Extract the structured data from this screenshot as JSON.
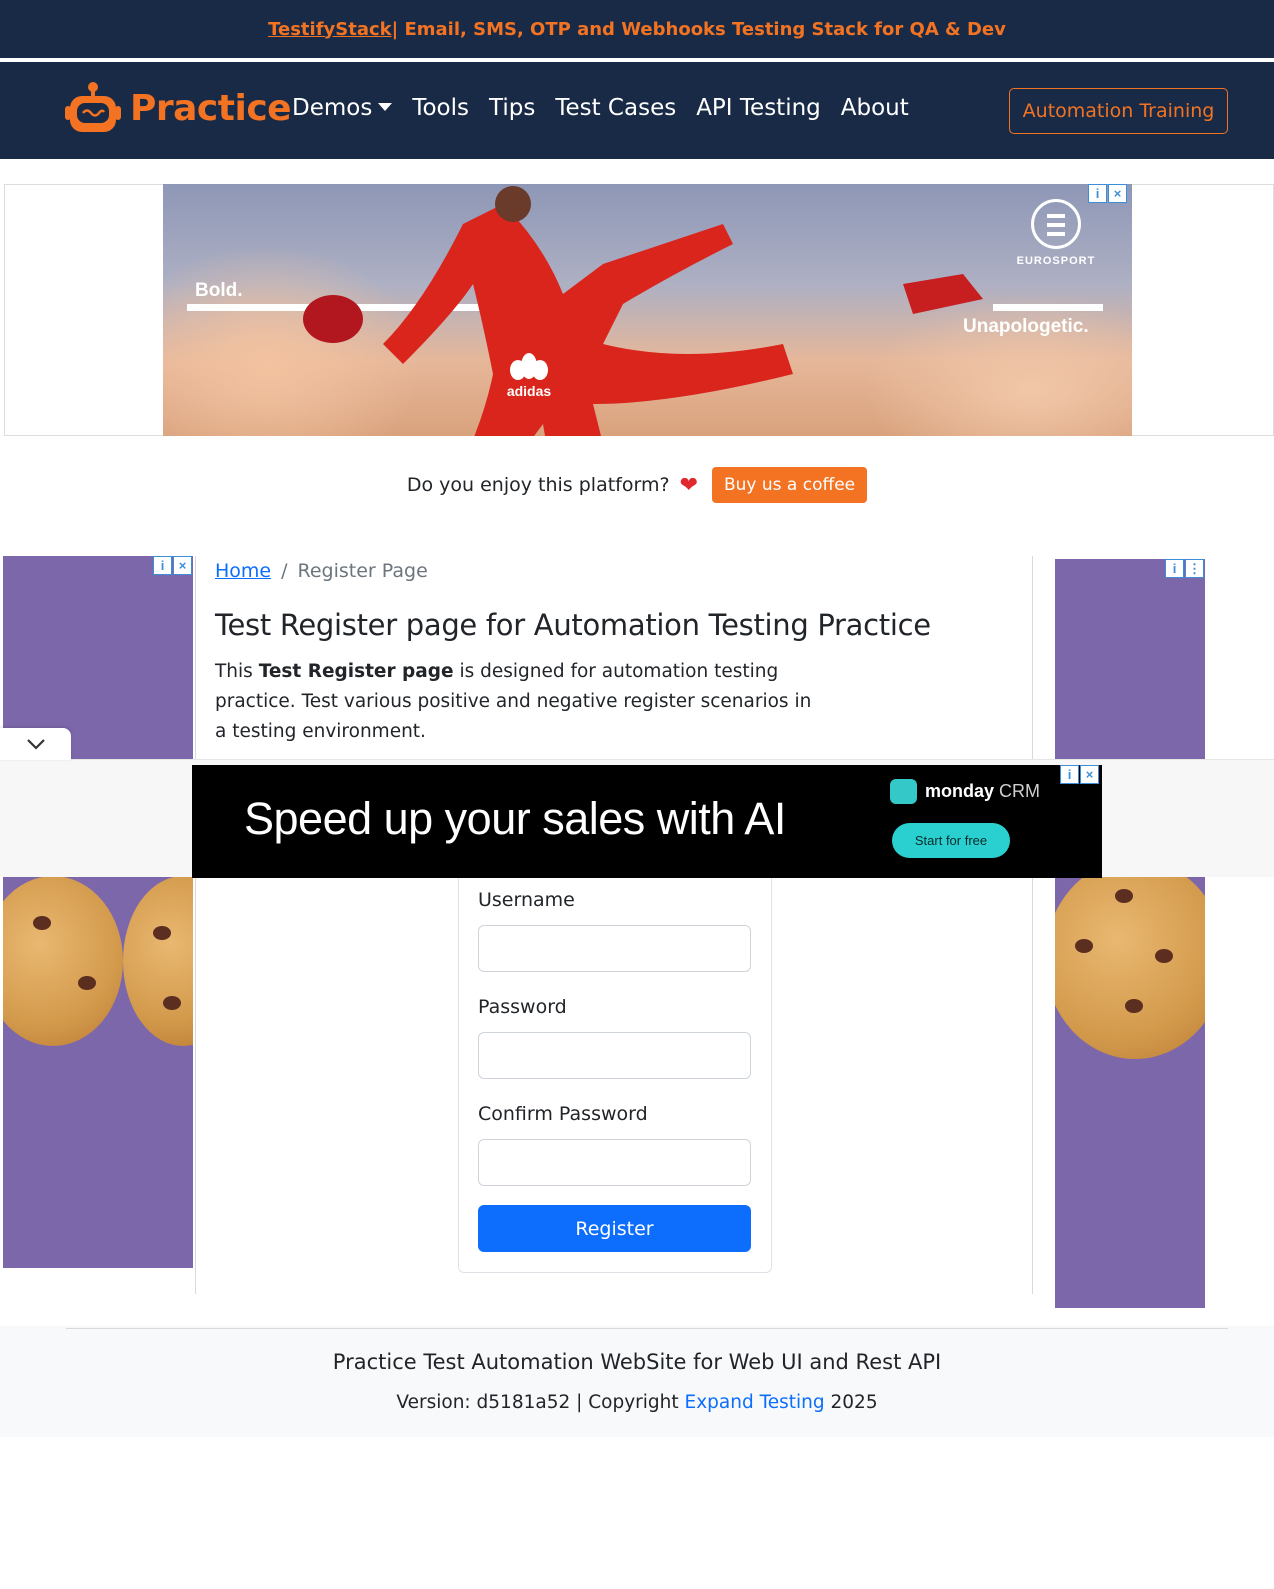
{
  "announcement": {
    "link_text": "TestifyStack",
    "rest_text": " | Email, SMS, OTP and Webhooks Testing Stack for QA & Dev"
  },
  "navbar": {
    "brand": "Practice",
    "links": [
      "Demos",
      "Tools",
      "Tips",
      "Test Cases",
      "API Testing",
      "About"
    ],
    "cta": "Automation Training"
  },
  "top_ad": {
    "left_word": "Bold.",
    "right_word": "Unapologetic.",
    "brand_mark": "adidas",
    "sponsor": "EUROSPORT"
  },
  "coffee": {
    "question": "Do you enjoy this platform?",
    "button": "Buy us a coffee"
  },
  "breadcrumb": {
    "home": "Home",
    "separator": "/",
    "current": "Register Page"
  },
  "page": {
    "title": "Test Register page for Automation Testing Practice",
    "intro_prefix": "This ",
    "intro_bold": "Test Register page",
    "intro_suffix": " is designed for automation testing practice. Test various positive and negative register scenarios in a testing environment."
  },
  "anchor_ad": {
    "headline": "Speed up your sales with AI",
    "brand_bold": "monday",
    "brand_suffix": "CRM",
    "button": "Start for free"
  },
  "form": {
    "username_label": "Username",
    "username_value": "",
    "password_label": "Password",
    "password_value": "",
    "confirm_label": "Confirm Password",
    "confirm_value": "",
    "submit": "Register"
  },
  "footer": {
    "title": "Practice Test Automation WebSite for Web UI and Rest API",
    "version_prefix": "Version: d5181a52 | Copyright ",
    "link": "Expand Testing",
    "year": " 2025"
  },
  "colors": {
    "navy": "#182a45",
    "orange": "#f37323",
    "primary_blue": "#0d6efd",
    "ad_purple": "#7d67ab"
  }
}
